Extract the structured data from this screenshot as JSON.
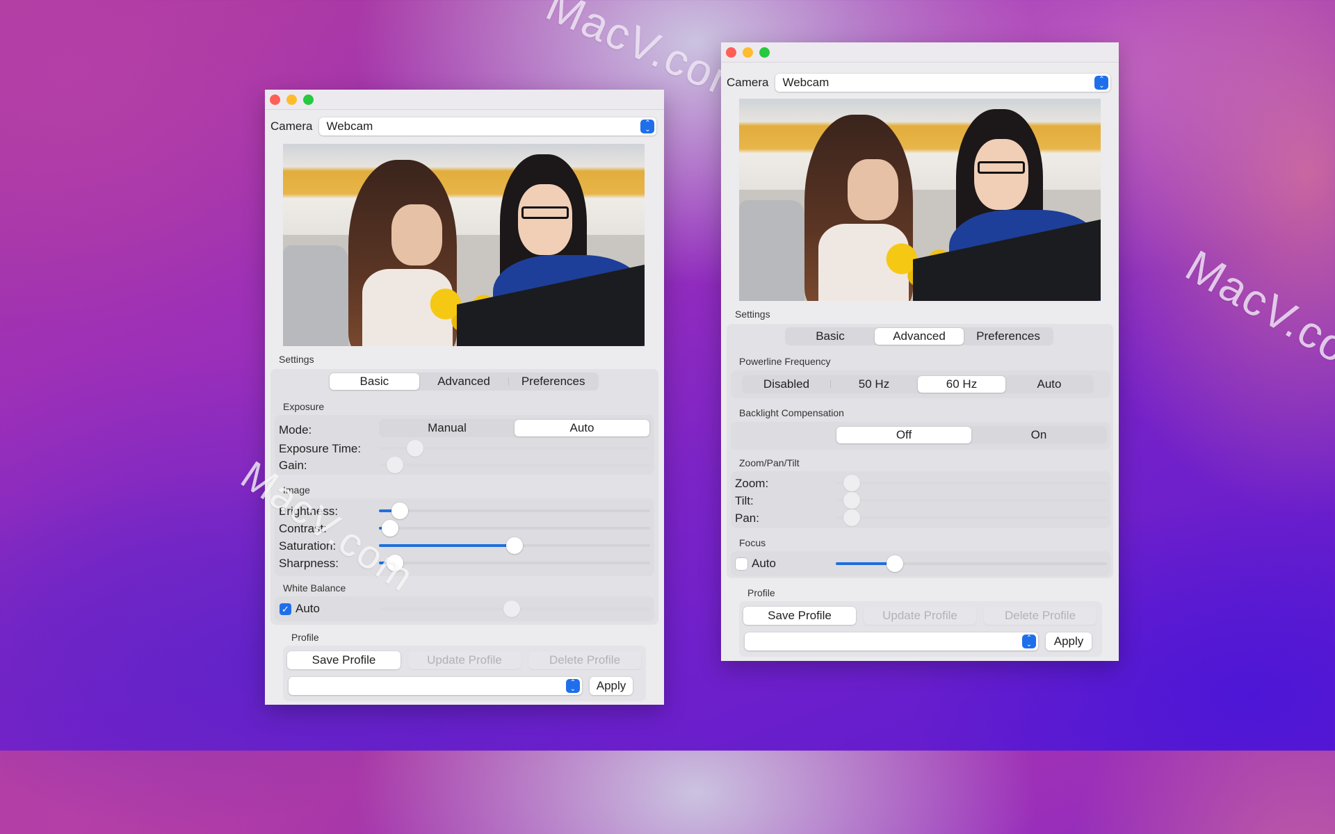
{
  "watermarks": [
    "MacV.com",
    "MacV.com",
    "MacV.com"
  ],
  "windows": [
    {
      "camera": {
        "label": "Camera",
        "selected": "Webcam"
      },
      "settings_label": "Settings",
      "tabs": [
        {
          "label": "Basic",
          "selected": true
        },
        {
          "label": "Advanced",
          "selected": false
        },
        {
          "label": "Preferences",
          "selected": false
        }
      ],
      "exposure": {
        "title": "Exposure",
        "mode_label": "Mode:",
        "mode_options": [
          {
            "label": "Manual",
            "selected": false
          },
          {
            "label": "Auto",
            "selected": true
          }
        ],
        "exposure_time_label": "Exposure Time:",
        "exposure_time_value": 0.11,
        "gain_label": "Gain:",
        "gain_value": 0.03
      },
      "image": {
        "title": "Image",
        "sliders": [
          {
            "label": "Brightness:",
            "value": 0.05
          },
          {
            "label": "Contrast:",
            "value": 0.01
          },
          {
            "label": "Saturation:",
            "value": 0.5
          },
          {
            "label": "Sharpness:",
            "value": 0.03
          }
        ]
      },
      "white_balance": {
        "title": "White Balance",
        "auto_label": "Auto",
        "auto_checked": true,
        "value": 0.49
      },
      "profile": {
        "title": "Profile",
        "save_label": "Save Profile",
        "update_label": "Update Profile",
        "delete_label": "Delete Profile",
        "selected": "",
        "apply_label": "Apply"
      }
    },
    {
      "camera": {
        "label": "Camera",
        "selected": "Webcam"
      },
      "settings_label": "Settings",
      "tabs": [
        {
          "label": "Basic",
          "selected": false
        },
        {
          "label": "Advanced",
          "selected": true
        },
        {
          "label": "Preferences",
          "selected": false
        }
      ],
      "powerline": {
        "title": "Powerline Frequency",
        "options": [
          {
            "label": "Disabled",
            "selected": false
          },
          {
            "label": "50 Hz",
            "selected": false
          },
          {
            "label": "60 Hz",
            "selected": true
          },
          {
            "label": "Auto",
            "selected": false
          }
        ]
      },
      "backlight": {
        "title": "Backlight Compensation",
        "options": [
          {
            "label": "Off",
            "selected": true
          },
          {
            "label": "On",
            "selected": false
          }
        ]
      },
      "zpt": {
        "title": "Zoom/Pan/Tilt",
        "sliders": [
          {
            "label": "Zoom:",
            "value": 0.03
          },
          {
            "label": "Tilt:",
            "value": 0.03
          },
          {
            "label": "Pan:",
            "value": 0.03
          }
        ]
      },
      "focus": {
        "title": "Focus",
        "auto_label": "Auto",
        "auto_checked": false,
        "value": 0.2
      },
      "profile": {
        "title": "Profile",
        "save_label": "Save Profile",
        "update_label": "Update Profile",
        "delete_label": "Delete Profile",
        "selected": "",
        "apply_label": "Apply"
      }
    }
  ]
}
